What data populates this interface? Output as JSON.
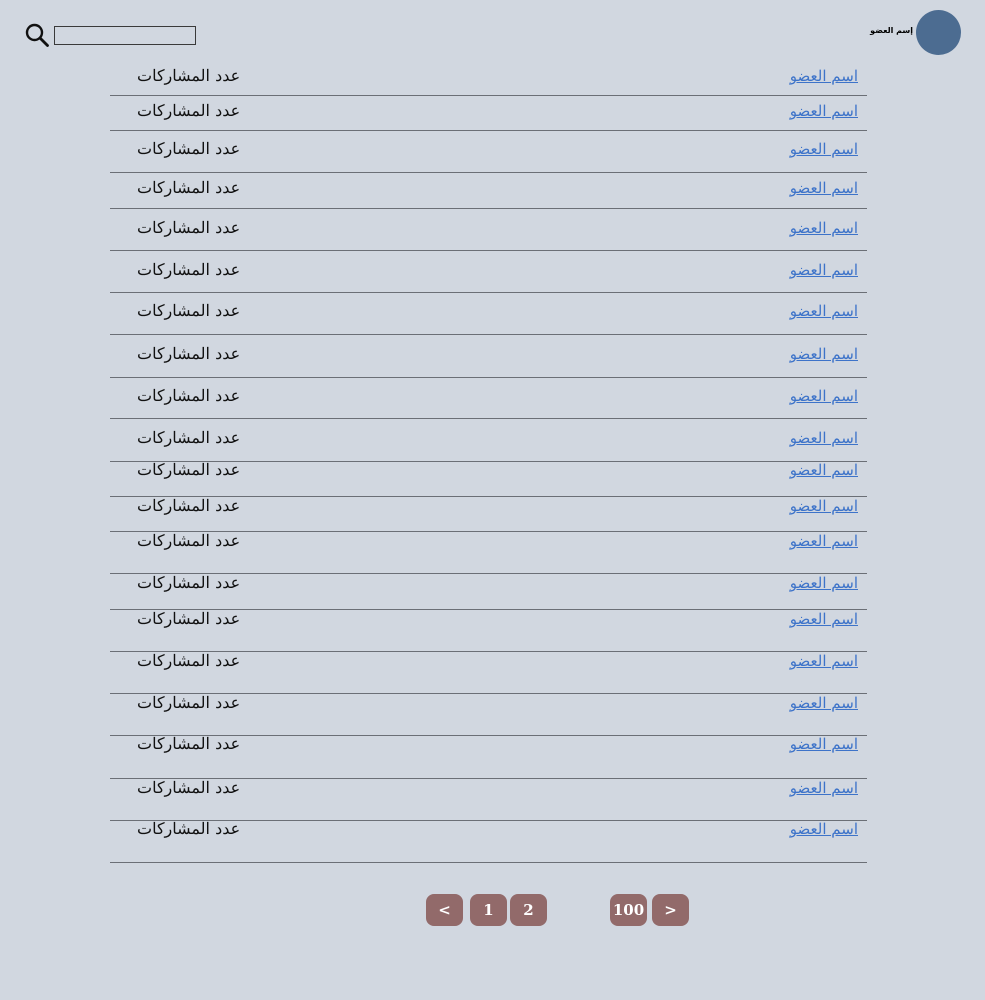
{
  "header": {
    "search_placeholder": "",
    "user_label": "إسم العضو"
  },
  "members": [
    {
      "name": "اسم العضو",
      "posts": "عدد المشاركات"
    },
    {
      "name": "اسم العضو",
      "posts": "عدد المشاركات"
    },
    {
      "name": "اسم العضو",
      "posts": "عدد المشاركات"
    },
    {
      "name": "اسم العضو",
      "posts": "عدد المشاركات"
    },
    {
      "name": "اسم العضو",
      "posts": "عدد المشاركات"
    },
    {
      "name": "اسم العضو",
      "posts": "عدد المشاركات"
    },
    {
      "name": "اسم العضو",
      "posts": "عدد المشاركات"
    },
    {
      "name": "اسم العضو",
      "posts": "عدد المشاركات"
    },
    {
      "name": "اسم العضو",
      "posts": "عدد المشاركات"
    },
    {
      "name": "اسم العضو",
      "posts": "عدد المشاركات"
    },
    {
      "name": "اسم العضو",
      "posts": "عدد المشاركات"
    },
    {
      "name": "اسم العضو",
      "posts": "عدد المشاركات"
    },
    {
      "name": "اسم العضو",
      "posts": "عدد المشاركات"
    },
    {
      "name": "اسم العضو",
      "posts": "عدد المشاركات"
    },
    {
      "name": "اسم العضو",
      "posts": "عدد المشاركات"
    },
    {
      "name": "اسم العضو",
      "posts": "عدد المشاركات"
    },
    {
      "name": "اسم العضو",
      "posts": "عدد المشاركات"
    },
    {
      "name": "اسم العضو",
      "posts": "عدد المشاركات"
    },
    {
      "name": "اسم العضو",
      "posts": "عدد المشاركات"
    },
    {
      "name": "اسم العضو",
      "posts": "عدد المشاركات"
    }
  ],
  "pagination": {
    "prev": "<",
    "page1": "1",
    "page2": "2",
    "last": "100",
    "next": ">"
  },
  "colors": {
    "background": "#d1d7e0",
    "link": "#3d73c9",
    "button": "#926a6a",
    "avatar": "#4c6c91"
  }
}
